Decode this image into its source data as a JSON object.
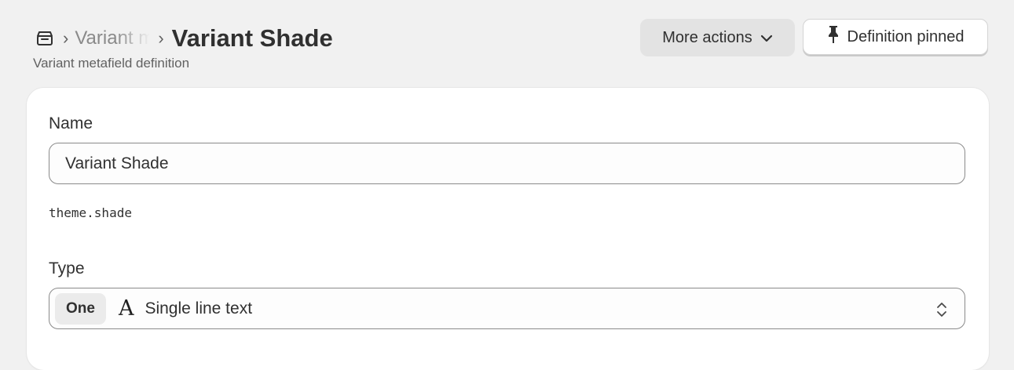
{
  "header": {
    "store_icon": "store-icon",
    "separator": "›",
    "breadcrumb_parent": "Variant metafield definitions",
    "title": "Variant Shade",
    "subtitle": "Variant metafield definition"
  },
  "actions": {
    "more_actions_label": "More actions",
    "more_actions_icon": "chevron-down-icon",
    "pinned_label": "Definition pinned",
    "pinned_icon": "pin-icon"
  },
  "form": {
    "name_label": "Name",
    "name_value": "Variant Shade",
    "key": "theme.shade",
    "type_label": "Type",
    "type_cardinality": "One",
    "type_icon_glyph": "A",
    "type_value": "Single line text",
    "type_select_icon": "select-updown-icon"
  },
  "colors": {
    "page_bg": "#f1f1f1",
    "card_bg": "#ffffff",
    "text": "#303030",
    "muted": "#616161",
    "secondary_button_bg": "#e3e3e3"
  }
}
